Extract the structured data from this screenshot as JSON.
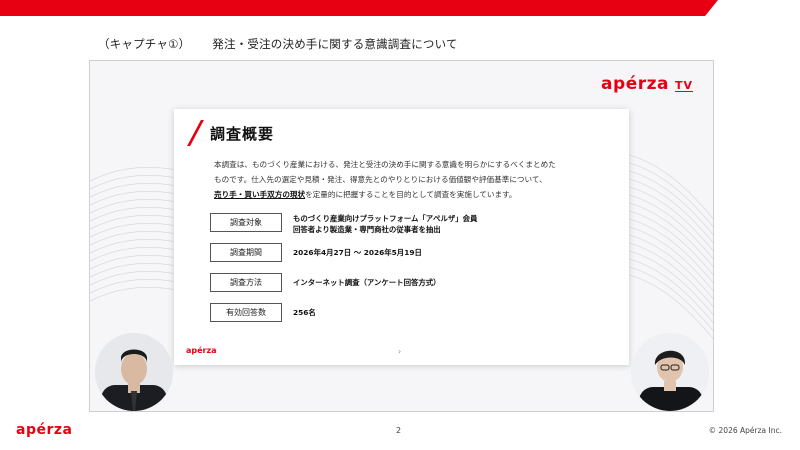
{
  "caption": {
    "left": "（キャプチャ①）",
    "title": "発注・受注の決め手に関する意識調査について"
  },
  "video": {
    "brand": "apérza",
    "tv": "TV"
  },
  "slide": {
    "title": "調査概要",
    "intro_1": "本調査は、ものづくり産業における、発注と受注の決め手に関する意識を明らかにするべくまとめた",
    "intro_2": "ものです。仕入先の選定や見積・発注、得意先とのやりとりにおける価値観や評価基準について、",
    "intro_em": "売り手・買い手双方の現状",
    "intro_3": "を定量的に把握することを目的として調査を実施しています。",
    "rows": [
      {
        "label": "調査対象",
        "value": "ものづくり産業向けプラットフォーム「アペルザ」会員",
        "value2": "回答者より製造業・専門商社の従事者を抽出"
      },
      {
        "label": "調査期間",
        "value": "2026年4月27日 ～ 2026年5月19日",
        "value2": ""
      },
      {
        "label": "調査方法",
        "value": "インターネット調査（アンケート回答方式）",
        "value2": ""
      },
      {
        "label": "有効回答数",
        "value": "256名",
        "value2": ""
      }
    ],
    "footer_logo": "apérza",
    "chevron": "›"
  },
  "footer": {
    "logo": "apérza",
    "page": "2",
    "copyright": "© 2026 Apérza Inc."
  },
  "colors": {
    "brand_red": "#e60012"
  }
}
